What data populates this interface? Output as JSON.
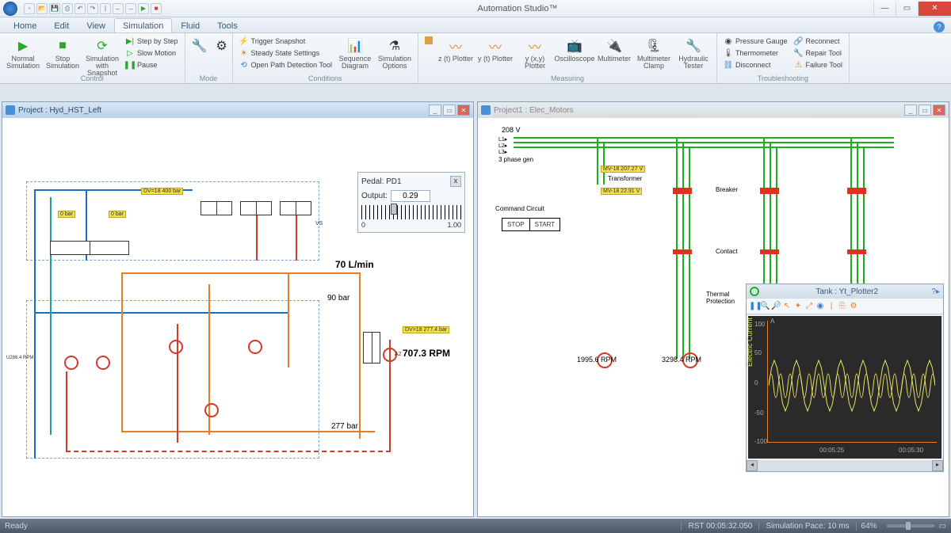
{
  "app_title": "Automation Studio™",
  "menu_tabs": [
    "Home",
    "Edit",
    "View",
    "Simulation",
    "Fluid",
    "Tools"
  ],
  "active_tab": "Simulation",
  "ribbon": {
    "control": {
      "label": "Control",
      "normal_sim": "Normal Simulation",
      "stop_sim": "Stop Simulation",
      "sim_snapshot": "Simulation with Snapshot",
      "step": "Step by Step",
      "slow": "Slow Motion",
      "pause": "Pause"
    },
    "mode": {
      "label": "Mode"
    },
    "conditions": {
      "label": "Conditions",
      "trigger": "Trigger Snapshot",
      "steady": "Steady State Settings",
      "openpath": "Open Path Detection Tool",
      "seq": "Sequence Diagram",
      "simopt": "Simulation Options"
    },
    "measuring": {
      "label": "Measuring",
      "zt": "z (t) Plotter",
      "yt": "y (t) Plotter",
      "yx": "y (x,y) Plotter",
      "osc": "Oscilloscope",
      "mm": "Multimeter",
      "mmc": "Multimeter Clamp",
      "hyd": "Hydraulic Tester"
    },
    "troubleshooting": {
      "label": "Troubleshooting",
      "pg": "Pressure Gauge",
      "th": "Thermometer",
      "disc": "Disconnect",
      "rec": "Reconnect",
      "rep": "Repair Tool",
      "fail": "Failure Tool"
    }
  },
  "left_project": {
    "title": "Project : Hyd_HST_Left",
    "pedal": {
      "title": "Pedal: PD1",
      "output_label": "Output:",
      "output_value": "0.29",
      "min": "0",
      "max": "1.00"
    },
    "readings": {
      "flow": "70 L/min",
      "pressure1": "90 bar",
      "rpm": "707.3 RPM",
      "pressure2": "277 bar"
    },
    "tags": {
      "t1": "DV=18   400 bar",
      "t2": "0 bar",
      "t3": "0 bar",
      "t4": "DV=18   277.4 bar"
    },
    "misc": {
      "vs": "VS",
      "a2": "A2",
      "leftmotor": "U286.4 RPM"
    }
  },
  "right_project": {
    "title": "Project1 : Elec_Motors",
    "voltage": "208 V",
    "phase": "3 phase gen",
    "labels": {
      "transformer": "Transformer",
      "breaker": "Breaker",
      "contact": "Contact",
      "thermal": "Thermal Protection",
      "cmd": "Command Circuit",
      "stop": "STOP",
      "start": "START"
    },
    "tags": {
      "m1": "MV-18   207.27 V",
      "m2": "MV-18   22.91 V"
    },
    "rpm1": "1995.6 RPM",
    "rpm2": "3298.4 RPM"
  },
  "plotter": {
    "title": "Tank : Yt_Plotter2",
    "ylabel": "Electric Current",
    "yunit": "A",
    "yticks": [
      "100",
      "50",
      "0",
      "-50",
      "-100"
    ],
    "xticks": [
      "00:05:25",
      "00:05:30"
    ]
  },
  "chart_data": {
    "type": "line",
    "title": "Tank : Yt_Plotter2",
    "ylabel": "Electric Current (A)",
    "ylim": [
      -100,
      100
    ],
    "x": [
      0,
      0.1,
      0.2,
      0.3,
      0.4,
      0.5,
      0.6,
      0.7,
      0.8,
      0.9,
      1.0,
      1.1,
      1.2,
      1.3,
      1.4,
      1.5,
      1.6,
      1.7,
      1.8,
      1.9,
      2.0,
      2.1,
      2.2,
      2.3,
      2.4,
      2.5,
      2.6,
      2.7,
      2.8,
      2.9,
      3.0,
      3.1,
      3.2,
      3.3,
      3.4,
      3.5,
      3.6,
      3.7,
      3.8,
      3.9,
      4.0,
      4.1,
      4.2,
      4.3,
      4.4,
      4.5,
      4.6,
      4.7,
      4.8,
      4.9,
      5.0,
      5.1,
      5.2,
      5.3,
      5.4,
      5.5,
      5.6,
      5.7,
      5.8,
      5.9,
      6.0
    ],
    "values": [
      0,
      28,
      40,
      28,
      0,
      -28,
      -40,
      -28,
      0,
      28,
      40,
      28,
      0,
      -28,
      -40,
      -28,
      0,
      28,
      40,
      28,
      0,
      -28,
      -40,
      -28,
      0,
      28,
      40,
      28,
      0,
      -28,
      -40,
      -28,
      0,
      28,
      40,
      28,
      0,
      -28,
      -40,
      -28,
      0,
      28,
      40,
      28,
      0,
      -28,
      -40,
      -28,
      0,
      28,
      40,
      28,
      0,
      -28,
      -40,
      -28,
      0,
      28,
      40,
      28,
      0
    ],
    "xticks": [
      "00:05:25",
      "00:05:30"
    ]
  },
  "statusbar": {
    "ready": "Ready",
    "rst": "RST 00:05:32.050",
    "pace": "Simulation Pace: 10 ms",
    "zoom": "64%"
  }
}
